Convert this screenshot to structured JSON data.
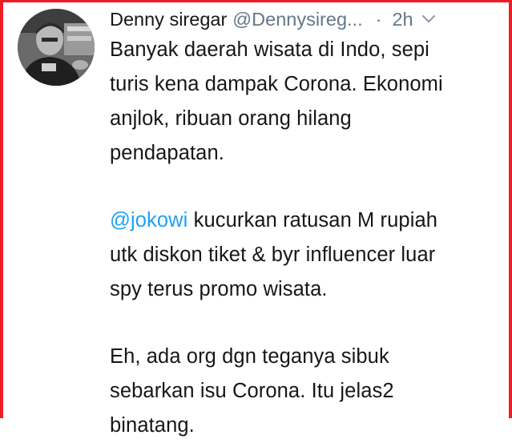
{
  "tweet": {
    "author": {
      "display_name": "Denny siregar",
      "handle": "@Dennysireg..."
    },
    "separator": "·",
    "time": "2h",
    "menu_icon": "chevron-down-icon",
    "avatar_icon": "user-photo",
    "paragraphs": [
      {
        "lines": [
          "Banyak daerah wisata di Indo, sepi",
          "turis kena dampak Corona. Ekonomi",
          "anjlok, ribuan orang hilang",
          "pendapatan."
        ]
      },
      {
        "mention": "@jokowi",
        "lines": [
          " kucurkan ratusan M rupiah",
          "utk diskon tiket  & byr influencer luar",
          "spy terus promo wisata."
        ]
      },
      {
        "lines": [
          "Eh, ada org dgn teganya sibuk",
          "sebarkan isu Corona. Itu jelas2",
          "binatang."
        ]
      }
    ]
  },
  "colors": {
    "frame": "#ee1c24",
    "text": "#14171a",
    "secondary": "#657786",
    "link": "#1da1f2"
  }
}
